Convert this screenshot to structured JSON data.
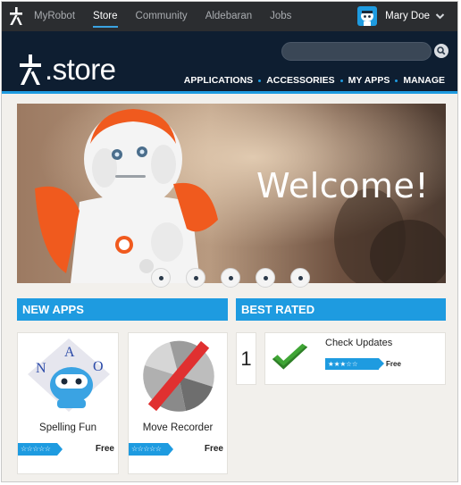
{
  "topbar": {
    "items": [
      {
        "label": "MyRobot",
        "active": false
      },
      {
        "label": "Store",
        "active": true
      },
      {
        "label": "Community",
        "active": false
      },
      {
        "label": "Aldebaran",
        "active": false
      },
      {
        "label": "Jobs",
        "active": false
      }
    ],
    "user_name": "Mary Doe"
  },
  "header": {
    "logo_text": ".store",
    "search_placeholder": "",
    "nav": [
      "APPLICATIONS",
      "ACCESSORIES",
      "MY APPS",
      "MANAGE"
    ]
  },
  "hero": {
    "headline": "Welcome!",
    "slide_count": 5
  },
  "new_apps": {
    "title": "NEW APPS",
    "apps": [
      {
        "name": "Spelling Fun",
        "price": "Free",
        "rating": "☆☆☆☆☆"
      },
      {
        "name": "Move Recorder",
        "price": "Free",
        "rating": "☆☆☆☆☆"
      }
    ]
  },
  "best_rated": {
    "title": "BEST RATED",
    "rank": "1",
    "app": {
      "name": "Check Updates",
      "price": "Free",
      "rating": "★★★☆☆"
    }
  },
  "colors": {
    "accent": "#1e9be0",
    "topbar": "#2b2d30",
    "header": "#0e1e31",
    "robot_orange": "#f05a1e"
  },
  "icons": [
    "aldebaran-logo-icon",
    "user-avatar-icon",
    "chevron-down-icon",
    "search-icon",
    "nao-robot-icon",
    "move-recorder-icon",
    "checkmark-icon",
    "star-icon"
  ]
}
